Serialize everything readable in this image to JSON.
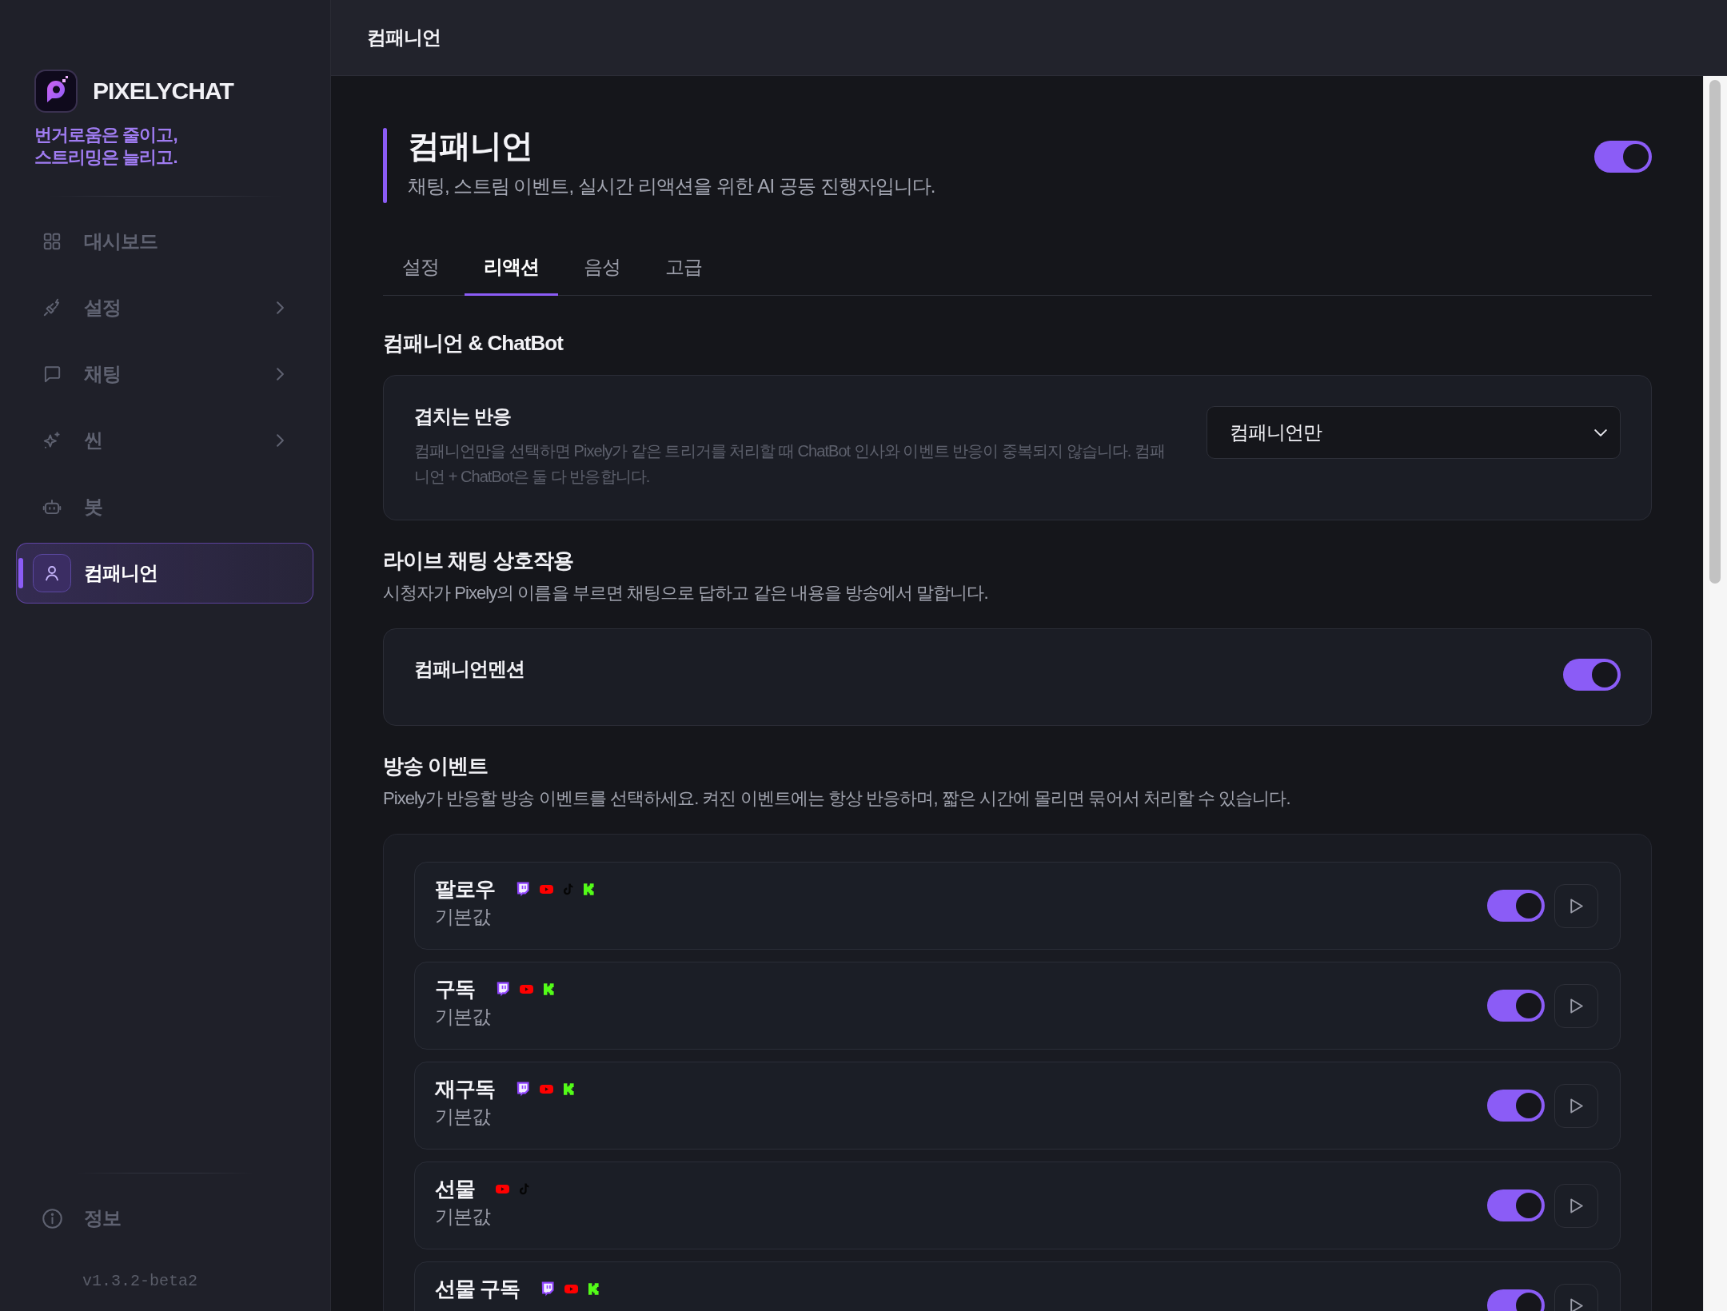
{
  "sidebar": {
    "brand": "PIXELYCHAT",
    "tagline": "번거로움은 줄이고,\n스트리밍은 늘리고.",
    "nav": [
      {
        "label": "대시보드",
        "selected": false,
        "has_submenu": false
      },
      {
        "label": "설정",
        "selected": false,
        "has_submenu": true
      },
      {
        "label": "채팅",
        "selected": false,
        "has_submenu": true
      },
      {
        "label": "씬",
        "selected": false,
        "has_submenu": true
      },
      {
        "label": "봇",
        "selected": false,
        "has_submenu": false
      },
      {
        "label": "컴패니언",
        "selected": true,
        "has_submenu": false
      }
    ],
    "footer_item": {
      "label": "정보"
    },
    "version": "v1.3.2-beta2"
  },
  "top_bar": {
    "title": "컴패니언"
  },
  "page": {
    "title": "컴패니언",
    "subtitle": "채팅, 스트림 이벤트, 실시간 리액션을 위한 AI 공동 진행자입니다.",
    "enabled": true
  },
  "tabs": [
    {
      "label": "설정",
      "selected": false
    },
    {
      "label": "리액션",
      "selected": true
    },
    {
      "label": "음성",
      "selected": false
    },
    {
      "label": "고급",
      "selected": false
    }
  ],
  "chatbot_section": {
    "heading": "컴패니언 & ChatBot",
    "setting": {
      "label": "겹치는 반응",
      "description": "컴패니언만을 선택하면 Pixely가 같은 트리거를 처리할 때 ChatBot 인사와 이벤트 반응이 중복되지 않습니다. 컴패니언 + ChatBot은 둘 다 반응합니다.",
      "value": "컴패니언만"
    }
  },
  "chat_section": {
    "heading": "라이브 채팅 상호작용",
    "description": "시청자가 Pixely의 이름을 부르면 채팅으로 답하고 같은 내용을 방송에서 말합니다.",
    "setting": {
      "label": "컴패니언멘션",
      "on": true
    }
  },
  "events_section": {
    "heading": "방송 이벤트",
    "description": "Pixely가 반응할 방송 이벤트를 선택하세요. 켜진 이벤트에는 항상 반응하며, 짧은 시간에 몰리면 묶어서 처리할 수 있습니다.",
    "events": [
      {
        "name": "팔로우",
        "platforms": [
          {
            "kind": "twitch"
          },
          {
            "kind": "youtube"
          },
          {
            "kind": "tiktok"
          },
          {
            "kind": "kick"
          }
        ],
        "subtitle": "기본값",
        "on": true
      },
      {
        "name": "구독",
        "platforms": [
          {
            "kind": "twitch"
          },
          {
            "kind": "youtube"
          },
          {
            "kind": "kick"
          }
        ],
        "subtitle": "기본값",
        "on": true
      },
      {
        "name": "재구독",
        "platforms": [
          {
            "kind": "twitch"
          },
          {
            "kind": "youtube"
          },
          {
            "kind": "kick"
          }
        ],
        "subtitle": "기본값",
        "on": true
      },
      {
        "name": "선물",
        "platforms": [
          {
            "kind": "youtube"
          },
          {
            "kind": "tiktok"
          }
        ],
        "subtitle": "기본값",
        "on": true
      },
      {
        "name": "선물 구독",
        "platforms": [
          {
            "kind": "twitch"
          },
          {
            "kind": "youtube"
          },
          {
            "kind": "kick"
          }
        ],
        "on": true
      }
    ]
  }
}
